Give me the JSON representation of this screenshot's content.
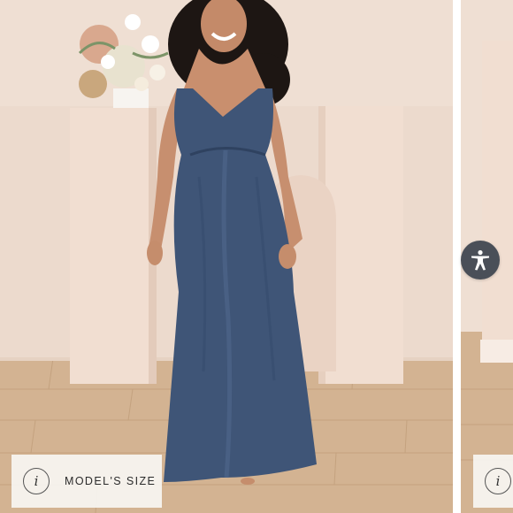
{
  "product_gallery": {
    "main_image_alt": "Model wearing a navy blue satin maxi dress",
    "model_size_button": {
      "info_icon": "info-icon",
      "info_glyph": "i",
      "label": "MODEL'S SIZE"
    },
    "next_slide_info_glyph": "i"
  },
  "accessibility_widget": {
    "icon": "accessibility-person-icon"
  },
  "colors": {
    "dress": "#3f5577",
    "wall": "#ecd9cc",
    "floor": "#cfae8c",
    "pedestal": "#f0ddd0",
    "a11y_button": "#4a4f58"
  }
}
